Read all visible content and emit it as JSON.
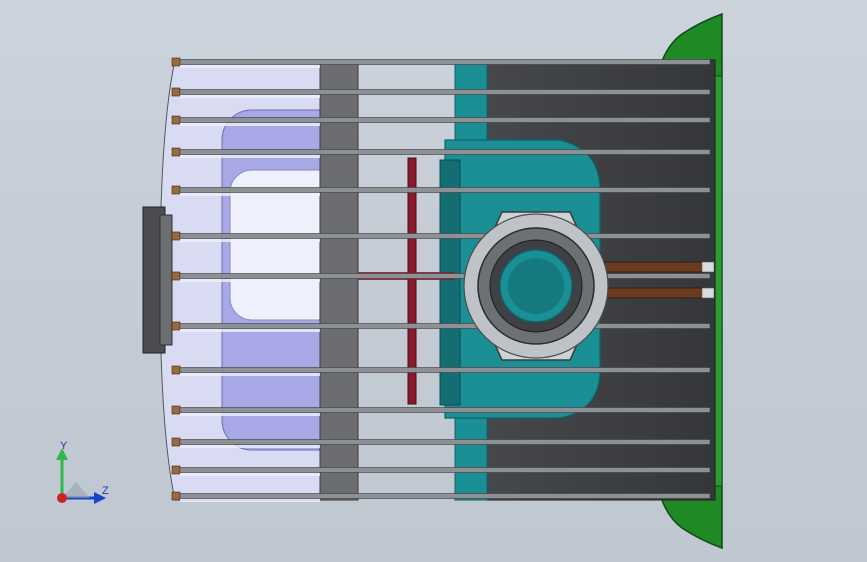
{
  "viewport": {
    "background_top": "#ccd3dc",
    "background_bottom": "#bfc7d1"
  },
  "model": {
    "colors": {
      "fin_light": "#d9dbf2",
      "fin_blue": "#a9a8e6",
      "fin_white": "#eef0fb",
      "shell_dark": "#3a3c3e",
      "shell_mid": "#6b6d70",
      "shell_light": "#9a9c9f",
      "rod": "#8d9094",
      "teal": "#1a8f95",
      "teal_dark": "#0e6469",
      "green": "#1f8a25",
      "green_dark": "#0b4d12",
      "red": "#8a1a2a",
      "brown": "#6a3b1e",
      "copper": "#9a6a3a",
      "nut": "#9ea2a6"
    }
  },
  "triad": {
    "y_label": "Y",
    "z_label": "Z",
    "y_color": "#2fb84a",
    "z_color": "#1a44c8",
    "origin_color": "#d02020"
  }
}
